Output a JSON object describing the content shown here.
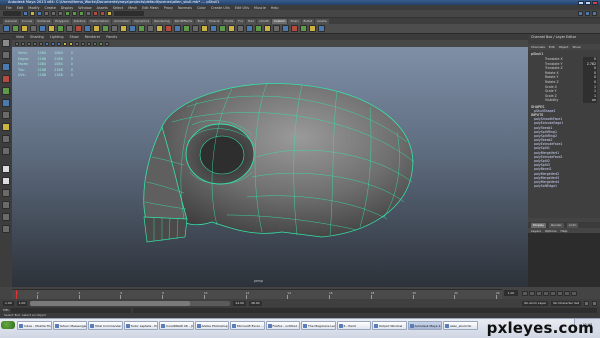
{
  "window": {
    "title": "Autodesk Maya 2013 x64: C:\\Users\\Nemo_Works\\Documents\\maya\\projects\\default\\scenes\\alien_skull.mb* --- pSkull1"
  },
  "menus": [
    "File",
    "Edit",
    "Modify",
    "Create",
    "Display",
    "Window",
    "Assets",
    "Select",
    "Mesh",
    "Edit Mesh",
    "Proxy",
    "Normals",
    "Color",
    "Create UVs",
    "Edit UVs",
    "Muscle",
    "Help"
  ],
  "shelf": {
    "tabs": [
      "General",
      "Curves",
      "Surfaces",
      "Polygons",
      "Subdivs",
      "Deformation",
      "Animation",
      "Dynamics",
      "Rendering",
      "PaintEffects",
      "Toon",
      "Muscle",
      "Fluids",
      "Fur",
      "Hair",
      "nCloth",
      "Custom",
      "XGen",
      "Bullet",
      "Goalie"
    ],
    "active_tab": "Custom"
  },
  "panel": {
    "menus": [
      "View",
      "Shading",
      "Lighting",
      "Show",
      "Renderer",
      "Panels"
    ],
    "camera": "persp"
  },
  "hud": {
    "rows": [
      {
        "label": "Verts:",
        "a": "1084",
        "b": "1084",
        "c": "0"
      },
      {
        "label": "Edges:",
        "a": "2166",
        "b": "2166",
        "c": "0"
      },
      {
        "label": "Faces:",
        "a": "1084",
        "b": "1084",
        "c": "0"
      },
      {
        "label": "Tris:",
        "a": "2168",
        "b": "2168",
        "c": "0"
      },
      {
        "label": "UVs:",
        "a": "1188",
        "b": "1188",
        "c": "0"
      }
    ]
  },
  "channel_box": {
    "header": "Channel Box / Layer Editor",
    "menus": [
      "Channels",
      "Edit",
      "Object",
      "Show"
    ],
    "object": "pSkull1",
    "attributes": [
      {
        "name": "Translate X",
        "value": "0"
      },
      {
        "name": "Translate Y",
        "value": "2.782"
      },
      {
        "name": "Translate Z",
        "value": "0"
      },
      {
        "name": "Rotate X",
        "value": "0"
      },
      {
        "name": "Rotate Y",
        "value": "0"
      },
      {
        "name": "Rotate Z",
        "value": "0"
      },
      {
        "name": "Scale X",
        "value": "1"
      },
      {
        "name": "Scale Y",
        "value": "1"
      },
      {
        "name": "Scale Z",
        "value": "1"
      },
      {
        "name": "Visibility",
        "value": "on"
      }
    ],
    "shapes_label": "SHAPES",
    "shape_name": "pSkullShape1",
    "inputs_label": "INPUTS",
    "inputs": [
      "polySmoothFace1",
      "polyExtrudeEdge1",
      "polyTweak1",
      "polySplitRing1",
      "polySplitRing2",
      "polyTweak2",
      "polyExtrudeFace1",
      "polySplit1",
      "polyMergeVert1",
      "polyExtrudeFace2",
      "polySplit2",
      "polySplit3",
      "polyBevel1",
      "polyMergeVert2",
      "polyMergeVert3",
      "polyMergeVert4",
      "polySoftEdge1"
    ]
  },
  "layer_editor": {
    "tabs": [
      "Display",
      "Render",
      "Anim"
    ],
    "active_tab": "Display",
    "menus": [
      "Layers",
      "Options",
      "Help"
    ]
  },
  "timeline": {
    "ticks": [
      "1",
      "2",
      "4",
      "6",
      "8",
      "10",
      "12",
      "14",
      "16",
      "18",
      "20",
      "22",
      "24"
    ],
    "current_frame": "1.00"
  },
  "range": {
    "start": "1.00",
    "inner_start": "1.00",
    "inner_end": "24.00",
    "end": "48.00",
    "anim_layer": "No Anim Layer",
    "char_set": "No Character Set"
  },
  "command": {
    "label": "MEL",
    "value": ""
  },
  "help_line": "Select Tool: select an object",
  "taskbar": {
    "tasks": [
      "Inbox - Mozilla Thu...",
      "Yahoo! Messenger",
      "Total Commander 7...",
      "Tudor Leptalis - Pi...",
      "CorelDRAW X6 - [G...",
      "Adobe Photoshop ...",
      "Microsoft Excel - ...",
      "Firefox - untitled ...",
      "The Magicians Leo...",
      "6 - Paint",
      "Output Window",
      "Autodesk Maya 2...",
      "alien_skull.mb"
    ],
    "active_index": 11,
    "clock": "12:07"
  },
  "watermark": "pxleyes.com",
  "colors": {
    "wireframe": "#35e3a7",
    "selection": "#586a86"
  }
}
